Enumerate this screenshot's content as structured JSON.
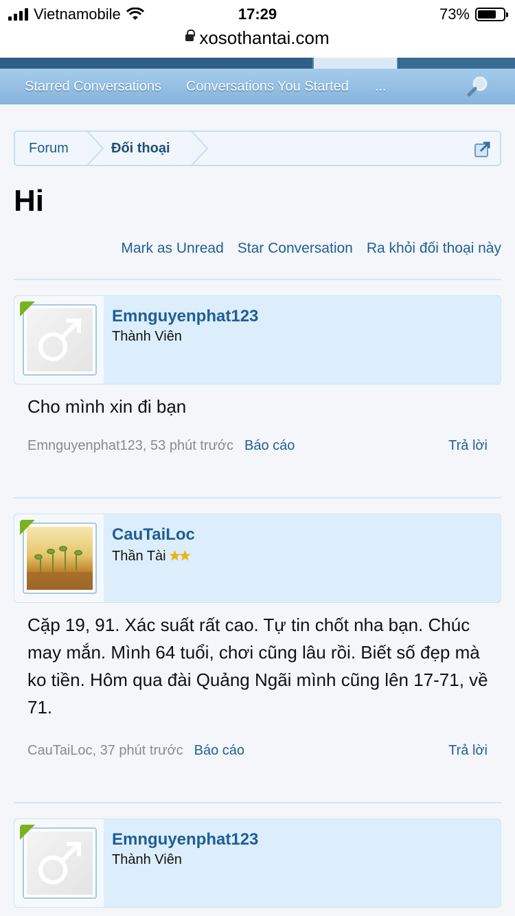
{
  "status": {
    "carrier": "Vietnamobile",
    "time": "17:29",
    "battery": "73%",
    "battery_level": 0.73
  },
  "url": "xosothantai.com",
  "subnav": {
    "items": [
      "Starred Conversations",
      "Conversations You Started",
      "..."
    ]
  },
  "breadcrumb": [
    "Forum",
    "Đối thoại"
  ],
  "title": "Hi",
  "actions": [
    "Mark as Unread",
    "Star Conversation",
    "Ra khỏi đối thoại này"
  ],
  "messages": [
    {
      "username": "Emnguyenphat123",
      "user_title": "Thành Viên",
      "avatar": "male-symbol-icon",
      "body": "Cho mình xin đi bạn",
      "meta": "Emnguyenphat123, 53 phút trước",
      "report": "Báo cáo",
      "reply": "Trả lời"
    },
    {
      "username": "CauTaiLoc",
      "user_title": "Thần Tài",
      "stars": "★★",
      "avatar": "sprouts-photo",
      "body": "Cặp 19, 91. Xác suất rất cao. Tự tin chốt nha bạn. Chúc may mắn. Mình 64 tuổi, chơi cũng lâu rồi. Biết số đẹp mà ko tiền. Hôm qua đài Quảng Ngãi mình cũng lên 17-71, về 71.",
      "meta": "CauTaiLoc, 37 phút trước",
      "report": "Báo cáo",
      "reply": "Trả lời"
    },
    {
      "username": "Emnguyenphat123",
      "user_title": "Thành Viên",
      "avatar": "male-symbol-icon"
    }
  ],
  "colors": {
    "link": "#1f5f95",
    "nav_dark": "#2f5f87",
    "msg_head": "#dceefb",
    "badge": "#78b21e"
  }
}
